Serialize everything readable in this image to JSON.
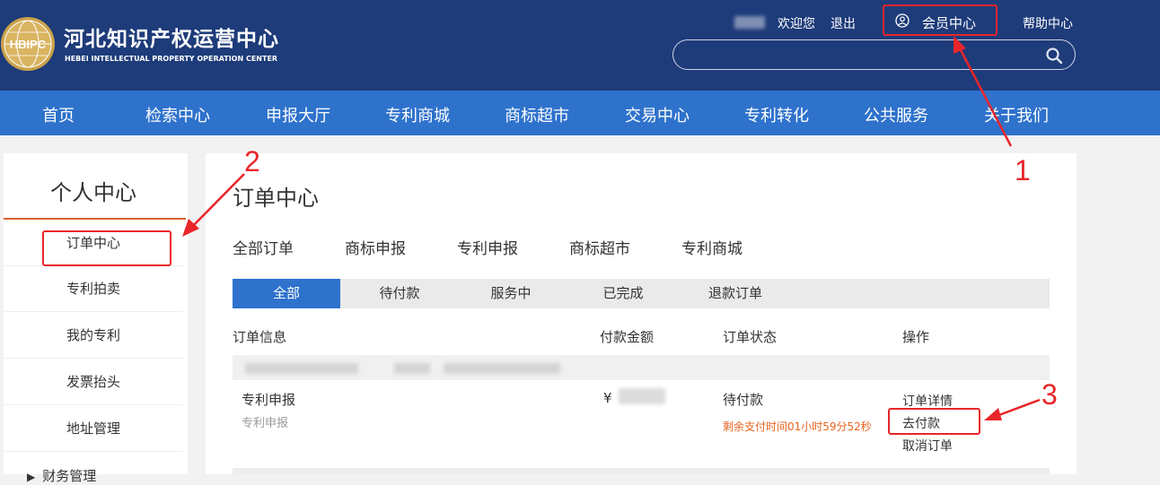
{
  "header": {
    "brand_cn": "河北知识产权运营中心",
    "brand_en": "HEBEI INTELLECTUAL PROPERTY OPERATION CENTER",
    "logo_text": "HBIPC",
    "welcome": "欢迎您",
    "logout": "退出",
    "member_center": "会员中心",
    "help_center": "帮助中心",
    "search_placeholder": ""
  },
  "nav": {
    "items": [
      "首页",
      "检索中心",
      "申报大厅",
      "专利商城",
      "商标超市",
      "交易中心",
      "专利转化",
      "公共服务",
      "关于我们"
    ]
  },
  "sidebar": {
    "title": "个人中心",
    "items": [
      "订单中心",
      "专利拍卖",
      "我的专利",
      "发票抬头",
      "地址管理"
    ],
    "more": "财务管理"
  },
  "main": {
    "title": "订单中心",
    "category_tabs": [
      "全部订单",
      "商标申报",
      "专利申报",
      "商标超市",
      "专利商城"
    ],
    "status_tabs": [
      "全部",
      "待付款",
      "服务中",
      "已完成",
      "退款订单"
    ],
    "active_status_tab": "全部",
    "columns": [
      "订单信息",
      "付款金额",
      "订单状态",
      "操作"
    ],
    "order": {
      "name": "专利申报",
      "subtype": "专利申报",
      "amount_prefix": "¥",
      "status": "待付款",
      "countdown": "剩余支付时间01小时59分52秒",
      "actions": [
        "订单详情",
        "去付款",
        "取消订单"
      ]
    }
  },
  "annotations": {
    "labels": [
      "1",
      "2",
      "3"
    ],
    "color": "#e8262a"
  },
  "colors": {
    "header_bg": "#1e3b7a",
    "nav_bg": "#2e72cc",
    "accent_orange": "#e8621e"
  }
}
